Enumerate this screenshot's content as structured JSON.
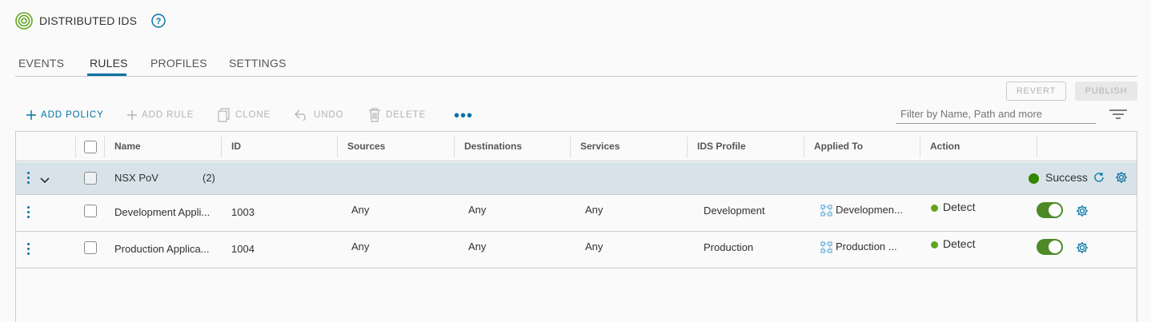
{
  "header": {
    "title": "DISTRIBUTED IDS"
  },
  "tabs": [
    {
      "label": "EVENTS"
    },
    {
      "label": "RULES",
      "active": true
    },
    {
      "label": "PROFILES"
    },
    {
      "label": "SETTINGS"
    }
  ],
  "actions": {
    "revert": "REVERT",
    "publish": "PUBLISH"
  },
  "toolbar": {
    "add_policy": "ADD POLICY",
    "add_rule": "ADD RULE",
    "clone": "CLONE",
    "undo": "UNDO",
    "delete": "DELETE",
    "more": "•••"
  },
  "filter": {
    "placeholder": "Filter by Name, Path and more"
  },
  "table": {
    "columns": [
      "Name",
      "ID",
      "Sources",
      "Destinations",
      "Services",
      "IDS Profile",
      "Applied To",
      "Action"
    ],
    "group": {
      "name": "NSX PoV",
      "count": "(2)",
      "status": "Success"
    },
    "rows": [
      {
        "name": "Development Appli...",
        "id": "1003",
        "sources": "Any",
        "destinations": "Any",
        "services": "Any",
        "profile": "Development",
        "applied_to": "Developmen...",
        "action": "Detect",
        "enabled": true
      },
      {
        "name": "Production Applica...",
        "id": "1004",
        "sources": "Any",
        "destinations": "Any",
        "services": "Any",
        "profile": "Production",
        "applied_to": "Production ...",
        "action": "Detect",
        "enabled": true
      }
    ]
  },
  "colors": {
    "accent": "#0072a3",
    "success": "#318700",
    "toggle_on": "#4d8a26",
    "group_bg": "#d8e3e9"
  }
}
